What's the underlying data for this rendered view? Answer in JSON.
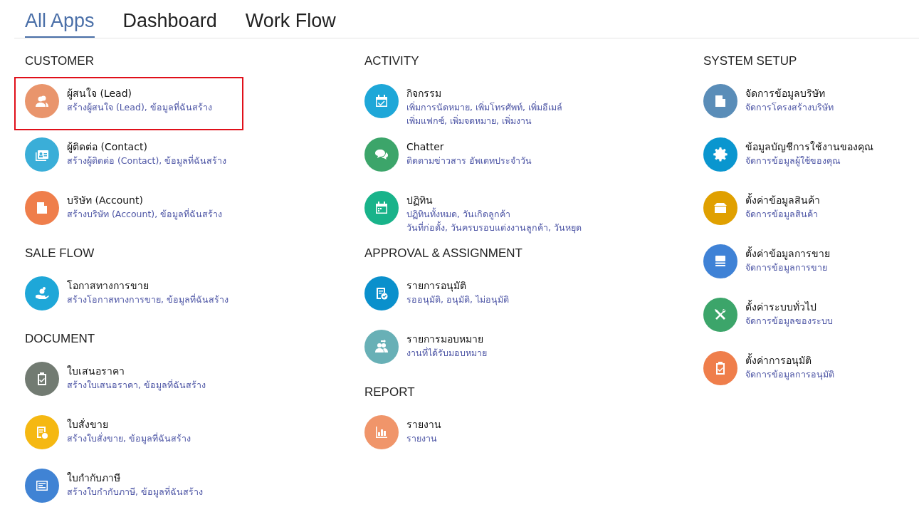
{
  "tabs": [
    {
      "label": "All Apps",
      "selected": true
    },
    {
      "label": "Dashboard",
      "selected": false
    },
    {
      "label": "Work Flow",
      "selected": false
    }
  ],
  "columns": [
    {
      "sections": [
        {
          "heading": "CUSTOMER",
          "items": [
            {
              "title": "ผู้สนใจ (Lead)",
              "lines": [
                "สร้างผู้สนใจ (Lead), ข้อมูลที่ฉันสร้าง"
              ],
              "kind": "people",
              "color": "#e9956c",
              "selected": true
            },
            {
              "title": "ผู้ติดต่อ (Contact)",
              "lines": [
                "สร้างผู้ติดต่อ (Contact), ข้อมูลที่ฉันสร้าง"
              ],
              "kind": "card",
              "color": "#3aaed8",
              "selected": false
            },
            {
              "title": "บริษัท (Account)",
              "lines": [
                "สร้างบริษัท (Account), ข้อมูลที่ฉันสร้าง"
              ],
              "kind": "building",
              "color": "#ef7e4b",
              "selected": false
            }
          ]
        },
        {
          "heading": "SALE FLOW",
          "items": [
            {
              "title": "โอกาสทางการขาย",
              "lines": [
                "สร้างโอกาสทางการขาย, ข้อมูลที่ฉันสร้าง"
              ],
              "kind": "coin",
              "color": "#1ea7d8",
              "selected": false
            }
          ]
        },
        {
          "heading": "DOCUMENT",
          "items": [
            {
              "title": "ใบเสนอราคา",
              "lines": [
                "สร้างใบเสนอราคา, ข้อมูลที่ฉันสร้าง"
              ],
              "kind": "clipboard",
              "color": "#727b72",
              "selected": false
            },
            {
              "title": "ใบสั่งขาย",
              "lines": [
                "สร้างใบสั่งขาย, ข้อมูลที่ฉันสร้าง"
              ],
              "kind": "form",
              "color": "#f5b812",
              "selected": false
            },
            {
              "title": "ใบกำกับภาษี",
              "lines": [
                "สร้างใบกำกับภาษี, ข้อมูลที่ฉันสร้าง"
              ],
              "kind": "invoice",
              "color": "#4083d4",
              "selected": false
            }
          ]
        }
      ]
    },
    {
      "sections": [
        {
          "heading": "ACTIVITY",
          "items": [
            {
              "title": "กิจกรรม",
              "lines": [
                "เพิ่มการนัดหมาย, เพิ่มโทรศัพท์, เพิ่มอีเมล์",
                "เพิ่มแฟกซ์, เพิ่มจดหมาย, เพิ่มงาน"
              ],
              "kind": "task",
              "color": "#1ea7d8",
              "selected": false
            },
            {
              "title": "Chatter",
              "lines": [
                "ติดตามข่าวสาร อัพเดทประจำวัน"
              ],
              "kind": "chat",
              "color": "#3ca56a",
              "selected": false
            },
            {
              "title": "ปฏิทิน",
              "lines": [
                "ปฏิทินทั้งหมด, วันเกิดลูกค้า",
                "วันที่ก่อตั้ง, วันครบรอบแต่งงานลูกค้า, วันหยุด"
              ],
              "kind": "calendar",
              "color": "#19b38a",
              "selected": false
            }
          ]
        },
        {
          "heading": "APPROVAL & ASSIGNMENT",
          "items": [
            {
              "title": "รายการอนุมัติ",
              "lines": [
                "รออนุมัติ, อนุมัติ, ไม่อนุมัติ"
              ],
              "kind": "approval",
              "color": "#0a90cc",
              "selected": false
            },
            {
              "title": "รายการมอบหมาย",
              "lines": [
                "งานที่ได้รับมอบหมาย"
              ],
              "kind": "assign",
              "color": "#68b0b6",
              "selected": false
            }
          ]
        },
        {
          "heading": "REPORT",
          "items": [
            {
              "title": "รายงาน",
              "lines": [
                "รายงาน"
              ],
              "kind": "report",
              "color": "#f0956a",
              "selected": false
            }
          ]
        }
      ]
    },
    {
      "sections": [
        {
          "heading": "SYSTEM SETUP",
          "items": [
            {
              "title": "จัดการข้อมูลบริษัท",
              "lines": [
                "จัดการโครงสร้างบริษัท"
              ],
              "kind": "building",
              "color": "#5a8db8",
              "selected": false
            },
            {
              "title": "ข้อมูลบัญชีการใช้งานของคุณ",
              "lines": [
                "จัดการข้อมูลผู้ใช้ของคุณ"
              ],
              "kind": "settings",
              "color": "#0a96cf",
              "selected": false
            },
            {
              "title": "ตั้งค่าข้อมูลสินค้า",
              "lines": [
                "จัดการข้อมูลสินค้า"
              ],
              "kind": "product",
              "color": "#e0a000",
              "selected": false
            },
            {
              "title": "ตั้งค่าข้อมูลการขาย",
              "lines": [
                "จัดการข้อมูลการขาย"
              ],
              "kind": "sales",
              "color": "#3f82d6",
              "selected": false
            },
            {
              "title": "ตั้งค่าระบบทั่วไป",
              "lines": [
                "จัดการข้อมูลของระบบ"
              ],
              "kind": "system",
              "color": "#3ca56a",
              "selected": false
            },
            {
              "title": "ตั้งค่าการอนุมัติ",
              "lines": [
                "จัดการข้อมูลการอนุมัติ"
              ],
              "kind": "clipboard",
              "color": "#ef7e4b",
              "selected": false
            }
          ]
        }
      ]
    }
  ]
}
